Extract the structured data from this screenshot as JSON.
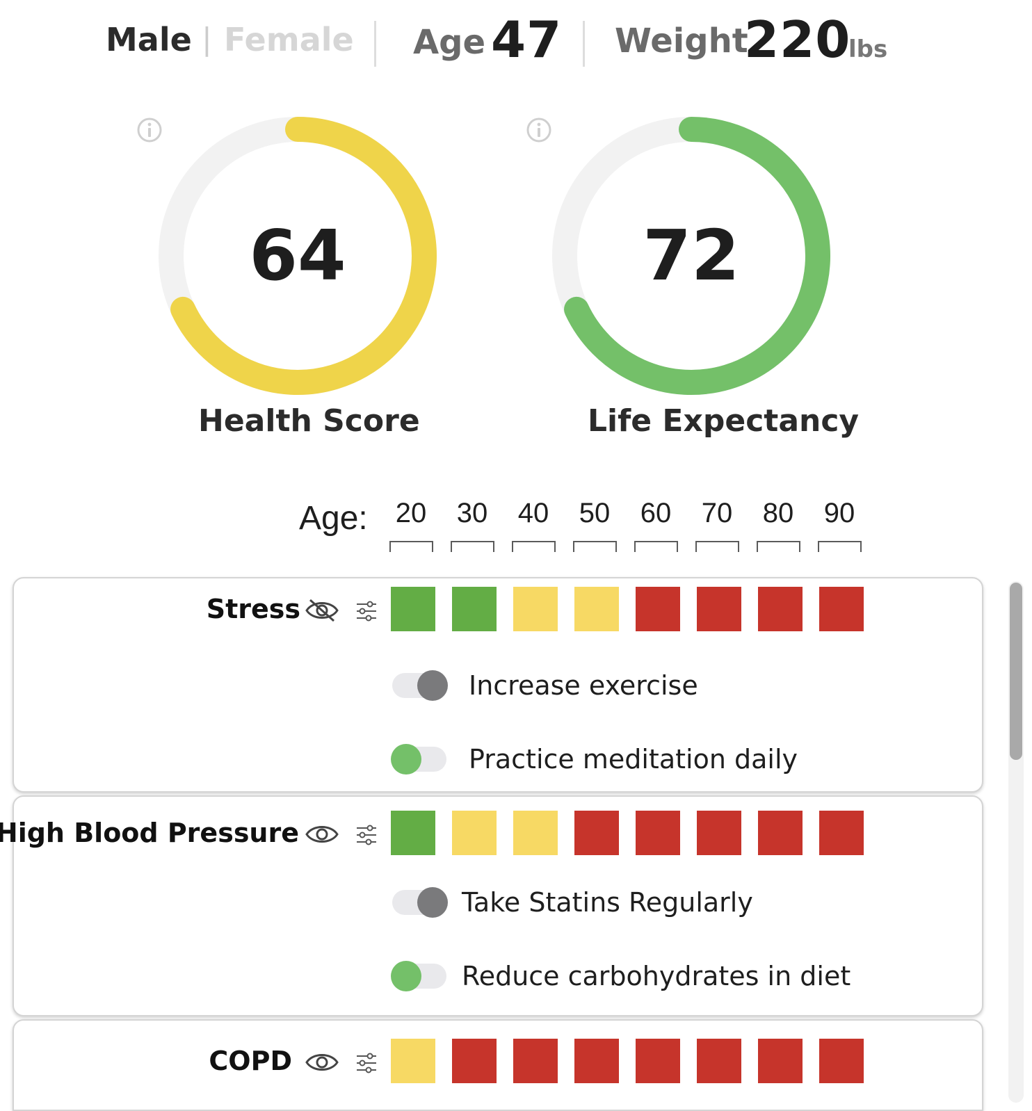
{
  "profile": {
    "sex_selected": "Male",
    "sex_separator": "|",
    "sex_other": "Female",
    "age_label": "Age",
    "age_value": "47",
    "weight_label": "Weight",
    "weight_value": "220",
    "weight_unit": "lbs"
  },
  "gauges": [
    {
      "label": "Health Score",
      "value": "64",
      "fraction": 0.64,
      "color": "#efd44a"
    },
    {
      "label": "Life Expectancy",
      "value": "72",
      "fraction": 0.72,
      "color": "#74c069"
    }
  ],
  "age_scale": {
    "label": "Age:",
    "ticks": [
      "20",
      "30",
      "40",
      "50",
      "60",
      "70",
      "80",
      "90"
    ]
  },
  "risk_colors": {
    "low": "#63ad45",
    "medium": "#f7d964",
    "high": "#c6342b"
  },
  "conditions": [
    {
      "name": "Stress",
      "visibility": "hidden",
      "risk": [
        "low",
        "low",
        "medium",
        "medium",
        "high",
        "high",
        "high",
        "high"
      ],
      "recommendations": [
        {
          "text": "Increase exercise",
          "enabled": false
        },
        {
          "text": "Practice meditation daily",
          "enabled": true
        }
      ]
    },
    {
      "name": "High Blood Pressure",
      "visibility": "visible",
      "risk": [
        "low",
        "medium",
        "medium",
        "high",
        "high",
        "high",
        "high",
        "high"
      ],
      "recommendations": [
        {
          "text": "Take Statins Regularly",
          "enabled": false
        },
        {
          "text": "Reduce carbohydrates in diet",
          "enabled": true
        }
      ]
    },
    {
      "name": "COPD",
      "visibility": "visible",
      "risk": [
        "medium",
        "high",
        "high",
        "high",
        "high",
        "high",
        "high",
        "high"
      ],
      "recommendations": []
    }
  ],
  "toggle_colors": {
    "on": "#74c069",
    "off": "#7a7a7c"
  }
}
